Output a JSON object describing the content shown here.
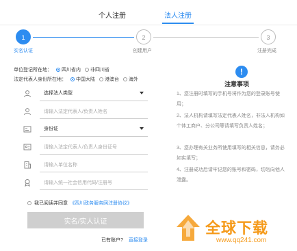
{
  "tabs": {
    "personal": "个人注册",
    "legal": "法人注册"
  },
  "steps": [
    {
      "number": "1",
      "label": "实名认证"
    },
    {
      "number": "2",
      "label": "创建用户"
    },
    {
      "number": "3",
      "label": "注册完成"
    }
  ],
  "form": {
    "location": {
      "label": "单位登记所在地：",
      "options": [
        "四川省内",
        "非四川省"
      ],
      "selected": "四川省内"
    },
    "id_location": {
      "label": "法定代表人身份所在地：",
      "options": [
        "中国大陆",
        "港澳台",
        "海外"
      ],
      "selected": "中国大陆"
    },
    "legal_type": {
      "value": "选择法人类型"
    },
    "legal_name": {
      "placeholder": "请输入法定代表人/负责人姓名"
    },
    "id_type": {
      "value": "身份证"
    },
    "id_number": {
      "placeholder": "请输入法定代表人/负责人身份证号"
    },
    "org_name": {
      "placeholder": "请输入单位名称"
    },
    "credit_code": {
      "placeholder": "请输入统一社会信用代码/注册号"
    },
    "agree": {
      "text": "我已阅读并同意",
      "link": "《四川政务服务网注册协议》"
    },
    "submit": "实名/实人认证",
    "login_prompt": "已有账户?",
    "login_link": "直接登录"
  },
  "notice": {
    "icon": "exclamation-icon",
    "title": "注意事项",
    "items": [
      "1、您注册时填写的手机号将作为您的登录账号使用；",
      "2、法人机构请填写法定代表人姓名，非法人机构如个体工商户、分公司等请填写负责人姓名；",
      "3、您办理有关业务所使用填写的相关信息，请务必如实填写；",
      "4、注册成功后请牢记您的账号和密码，切勿向他人泄露。"
    ]
  },
  "watermark": {
    "text": "全球下载",
    "url": "www.qq241.com"
  },
  "colors": {
    "accent": "#2d8cf0",
    "disabled_button": "#cfcfcf",
    "watermark": "#f59a1a"
  }
}
